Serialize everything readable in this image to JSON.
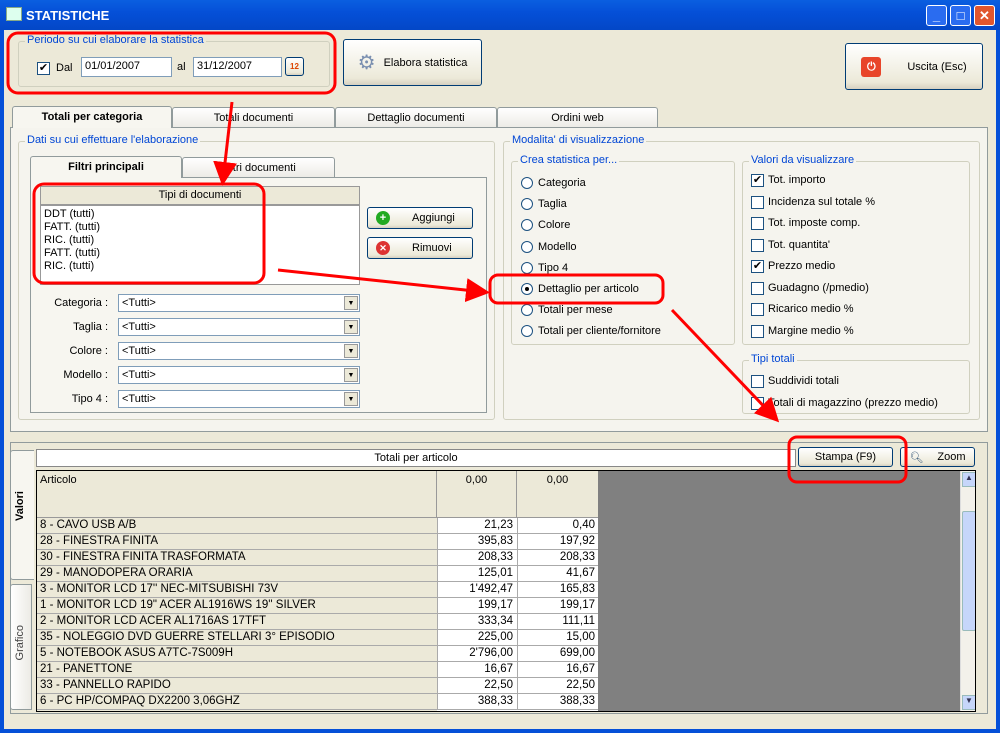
{
  "window": {
    "title": "STATISTICHE",
    "minimize": "_",
    "maximize": "□",
    "close": "✕"
  },
  "period": {
    "legend": "Periodo su cui elaborare la statistica",
    "dal_checked": true,
    "dal_label": "Dal",
    "from": "01/01/2007",
    "al_label": "al",
    "to": "31/12/2007"
  },
  "toolbar": {
    "elabora": "Elabora statistica",
    "uscita": "Uscita (Esc)"
  },
  "tabs": [
    "Totali per categoria",
    "Totali documenti",
    "Dettaglio documenti",
    "Ordini web"
  ],
  "dati": {
    "legend": "Dati su cui effettuare l'elaborazione",
    "subtabs": [
      "Filtri principali",
      "Filtri documenti"
    ],
    "list_header": "Tipi di documenti",
    "list": [
      "DDT (tutti)",
      "FATT. (tutti)",
      "RIC. (tutti)",
      "FATT. (tutti)",
      "RIC. (tutti)"
    ],
    "aggiungi": "Aggiungi",
    "rimuovi": "Rimuovi",
    "filters": [
      {
        "label": "Categoria :",
        "value": "<Tutti>"
      },
      {
        "label": "Taglia :",
        "value": "<Tutti>"
      },
      {
        "label": "Colore :",
        "value": "<Tutti>"
      },
      {
        "label": "Modello :",
        "value": "<Tutti>"
      },
      {
        "label": "Tipo 4 :",
        "value": "<Tutti>"
      }
    ]
  },
  "modalita": {
    "legend": "Modalita' di visualizzazione",
    "crea": {
      "legend": "Crea statistica per...",
      "options": [
        "Categoria",
        "Taglia",
        "Colore",
        "Modello",
        "Tipo 4",
        "Dettaglio per articolo",
        "Totali per mese",
        "Totali per cliente/fornitore"
      ],
      "selected": 5
    },
    "valori": {
      "legend": "Valori da visualizzare",
      "items": [
        {
          "label": "Tot. importo",
          "checked": true
        },
        {
          "label": "Incidenza sul totale %",
          "checked": false
        },
        {
          "label": "Tot. imposte comp.",
          "checked": false
        },
        {
          "label": "Tot. quantita'",
          "checked": false
        },
        {
          "label": "Prezzo medio",
          "checked": true
        },
        {
          "label": "Guadagno (/pmedio)",
          "checked": false
        },
        {
          "label": "Ricarico medio %",
          "checked": false
        },
        {
          "label": "Margine medio %",
          "checked": false
        }
      ]
    },
    "tipi": {
      "legend": "Tipi totali",
      "items": [
        {
          "label": "Suddividi totali",
          "checked": false
        },
        {
          "label": "Totali di magazzino (prezzo medio)",
          "checked": false
        }
      ]
    }
  },
  "results": {
    "side_tabs": [
      "Valori",
      "Grafico"
    ],
    "title": "Totali per articolo",
    "stampa": "Stampa (F9)",
    "zoom": "Zoom",
    "columns": [
      "Articolo",
      "0,00",
      "0,00"
    ],
    "rows": [
      [
        "8 - CAVO USB A/B",
        "21,23",
        "0,40"
      ],
      [
        "28 - FINESTRA FINITA",
        "395,83",
        "197,92"
      ],
      [
        "30 - FINESTRA FINITA TRASFORMATA",
        "208,33",
        "208,33"
      ],
      [
        "29 - MANODOPERA ORARIA",
        "125,01",
        "41,67"
      ],
      [
        "3 - MONITOR LCD 17'' NEC-MITSUBISHI 73V",
        "1'492,47",
        "165,83"
      ],
      [
        "1 - MONITOR LCD 19\" ACER AL1916WS 19'' SILVER",
        "199,17",
        "199,17"
      ],
      [
        "2 - MONITOR LCD ACER AL1716AS 17TFT",
        "333,34",
        "111,11"
      ],
      [
        "35 - NOLEGGIO DVD GUERRE STELLARI 3° EPISODIO",
        "225,00",
        "15,00"
      ],
      [
        "5 - NOTEBOOK ASUS A7TC-7S009H",
        "2'796,00",
        "699,00"
      ],
      [
        "21 - PANETTONE",
        "16,67",
        "16,67"
      ],
      [
        "33 - PANNELLO RAPIDO",
        "22,50",
        "22,50"
      ],
      [
        "6 - PC HP/COMPAQ DX2200 3,06GHZ",
        "388,33",
        "388,33"
      ]
    ]
  },
  "colors": {
    "annotation": "#ff0000",
    "titlebar": "#0550d8",
    "legend": "#0046d5",
    "grid_empty": "#808080"
  }
}
